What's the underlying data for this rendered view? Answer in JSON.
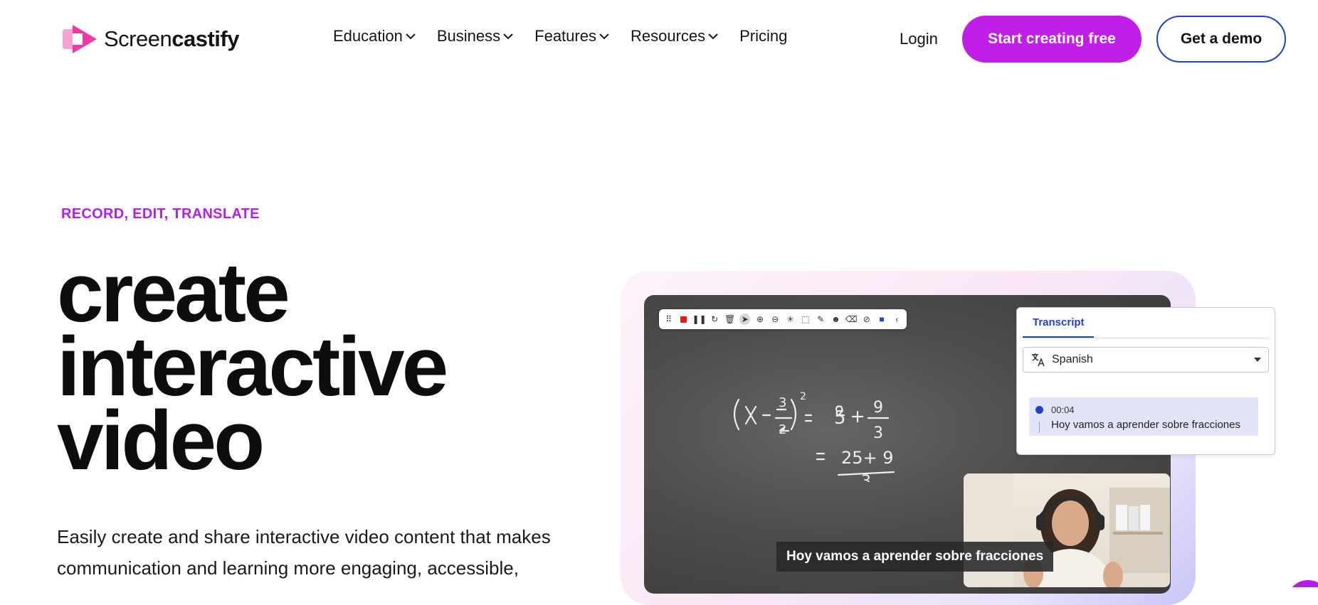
{
  "brand": {
    "name_light": "Screen",
    "name_bold": "castify",
    "accent": "#c11ee8",
    "link_blue": "#1d3fd6"
  },
  "nav": {
    "items": [
      {
        "label": "Education",
        "has_dropdown": true
      },
      {
        "label": "Business",
        "has_dropdown": true
      },
      {
        "label": "Features",
        "has_dropdown": true
      },
      {
        "label": "Resources",
        "has_dropdown": true
      },
      {
        "label": "Pricing",
        "has_dropdown": false
      }
    ],
    "login": "Login",
    "cta_primary": "Start creating free",
    "cta_secondary": "Get a demo"
  },
  "hero": {
    "eyebrow": "RECORD, EDIT, TRANSLATE",
    "headline_lines": [
      "create",
      "interactive",
      "video"
    ],
    "subtext_line1": "Easily create and share interactive video content that makes",
    "subtext_line2": "communication and learning more engaging, accessible,"
  },
  "media": {
    "toolbar_icons": [
      "drag-handle",
      "record-stop",
      "pause",
      "restart",
      "delete",
      "cursor",
      "zoom-in",
      "zoom-out",
      "spotlight",
      "crop",
      "pen",
      "emoji",
      "eraser",
      "hide-cursor",
      "webcam",
      "collapse"
    ],
    "math_lines": [
      "(X - 3/2)² = 5 + 9/3",
      "= 25 + 9 / 3"
    ],
    "transcript": {
      "tab": "Transcript",
      "language": "Spanish",
      "entry_time": "00:04",
      "entry_text": "Hoy vamos a aprender sobre fracciones"
    },
    "caption": "Hoy vamos a aprender sobre fracciones"
  }
}
